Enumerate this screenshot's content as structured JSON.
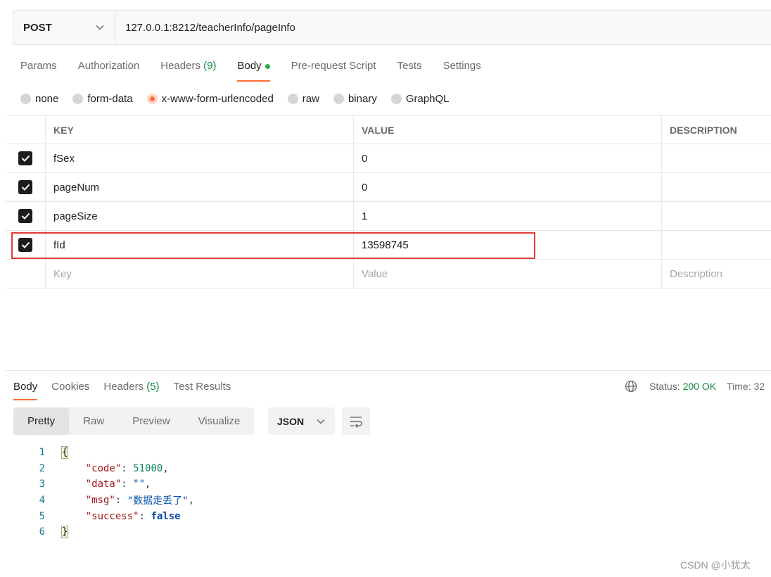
{
  "request": {
    "method": "POST",
    "url": "127.0.0.1:8212/teacherInfo/pageInfo"
  },
  "request_tabs": [
    {
      "label": "Params",
      "count": ""
    },
    {
      "label": "Authorization",
      "count": ""
    },
    {
      "label": "Headers",
      "count": "(9)"
    },
    {
      "label": "Body",
      "count": ""
    },
    {
      "label": "Pre-request Script",
      "count": ""
    },
    {
      "label": "Tests",
      "count": ""
    },
    {
      "label": "Settings",
      "count": ""
    }
  ],
  "body_types": [
    "none",
    "form-data",
    "x-www-form-urlencoded",
    "raw",
    "binary",
    "GraphQL"
  ],
  "selected_body_type": "x-www-form-urlencoded",
  "table": {
    "headers": {
      "key": "KEY",
      "value": "VALUE",
      "description": "DESCRIPTION"
    },
    "rows": [
      {
        "key": "fSex",
        "value": "0",
        "checked": true
      },
      {
        "key": "pageNum",
        "value": "0",
        "checked": true
      },
      {
        "key": "pageSize",
        "value": "1",
        "checked": true
      },
      {
        "key": "fId",
        "value": "13598745",
        "checked": true
      }
    ],
    "placeholders": {
      "key": "Key",
      "value": "Value",
      "description": "Description"
    }
  },
  "response_tabs": [
    {
      "label": "Body",
      "count": ""
    },
    {
      "label": "Cookies",
      "count": ""
    },
    {
      "label": "Headers",
      "count": "(5)"
    },
    {
      "label": "Test Results",
      "count": ""
    }
  ],
  "status": {
    "label": "Status:",
    "value": "200 OK",
    "time_label": "Time: 32"
  },
  "view_modes": [
    "Pretty",
    "Raw",
    "Preview",
    "Visualize"
  ],
  "format": "JSON",
  "response_lines": [
    {
      "n": "1",
      "text": "{"
    },
    {
      "n": "2",
      "key": "\"code\"",
      "sep": ": ",
      "val": "51000",
      "end": ","
    },
    {
      "n": "3",
      "key": "\"data\"",
      "sep": ": ",
      "val": "\"\"",
      "end": ","
    },
    {
      "n": "4",
      "key": "\"msg\"",
      "sep": ": ",
      "val": "\"数据走丢了\"",
      "end": ","
    },
    {
      "n": "5",
      "key": "\"success\"",
      "sep": ": ",
      "val": "false",
      "end": ""
    },
    {
      "n": "6",
      "text": "}"
    }
  ],
  "watermark": "CSDN @小犹太"
}
